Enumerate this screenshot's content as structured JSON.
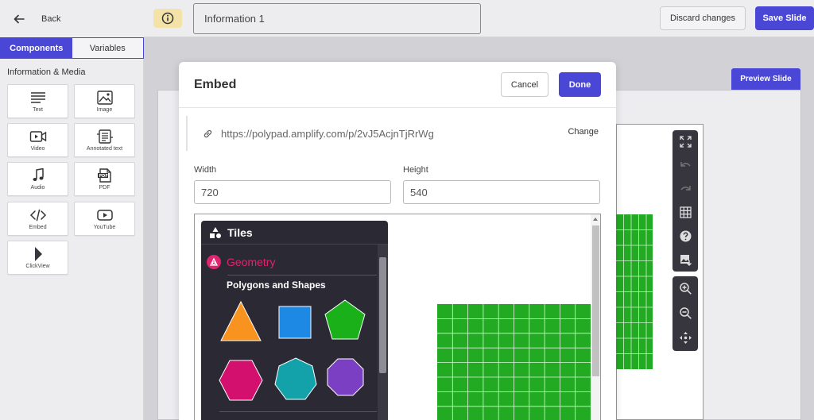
{
  "back": {
    "label": "Back"
  },
  "tabs": [
    {
      "label": "Components",
      "active": true
    },
    {
      "label": "Variables",
      "active": false
    }
  ],
  "section_title": "Information & Media",
  "components": [
    {
      "label": "Text",
      "icon": "text-lines-icon"
    },
    {
      "label": "Image",
      "icon": "image-icon"
    },
    {
      "label": "Video",
      "icon": "video-icon"
    },
    {
      "label": "Annotated text",
      "icon": "annotated-text-icon"
    },
    {
      "label": "Audio",
      "icon": "music-note-icon"
    },
    {
      "label": "PDF",
      "icon": "pdf-file-icon"
    },
    {
      "label": "Embed",
      "icon": "code-icon"
    },
    {
      "label": "YouTube",
      "icon": "youtube-icon"
    },
    {
      "label": "ClickView",
      "icon": "play-triangle-icon"
    }
  ],
  "topbar": {
    "slide_title": "Information 1",
    "discard_label": "Discard changes",
    "save_label": "Save Slide"
  },
  "preview_label": "Preview Slide",
  "modal": {
    "title": "Embed",
    "cancel_label": "Cancel",
    "done_label": "Done",
    "url": "https://polypad.amplify.com/p/2vJ5AcjnTjRrWg",
    "change_label": "Change",
    "width_label": "Width",
    "width_value": "720",
    "height_label": "Height",
    "height_value": "540"
  },
  "polypad": {
    "tiles_label": "Tiles",
    "category_label": "Geometry",
    "subcategory_label": "Polygons and Shapes"
  },
  "colors": {
    "accent": "#4a46d6",
    "info_button": "#f3e3a8",
    "geometry_pink": "#e0246e",
    "grid_green": "#22aa22",
    "triangle": "#f7931e",
    "square": "#1e88e5",
    "pentagon": "#1ab01a",
    "hexagon": "#d3106e",
    "heptagon": "#14a2aa",
    "octagon": "#7b3fc4"
  },
  "tool_rail": [
    "fullscreen-icon",
    "undo-icon",
    "redo-icon",
    "grid-icon",
    "help-icon",
    "image-download-icon",
    "zoom-in-icon",
    "zoom-out-icon",
    "move-icon"
  ]
}
